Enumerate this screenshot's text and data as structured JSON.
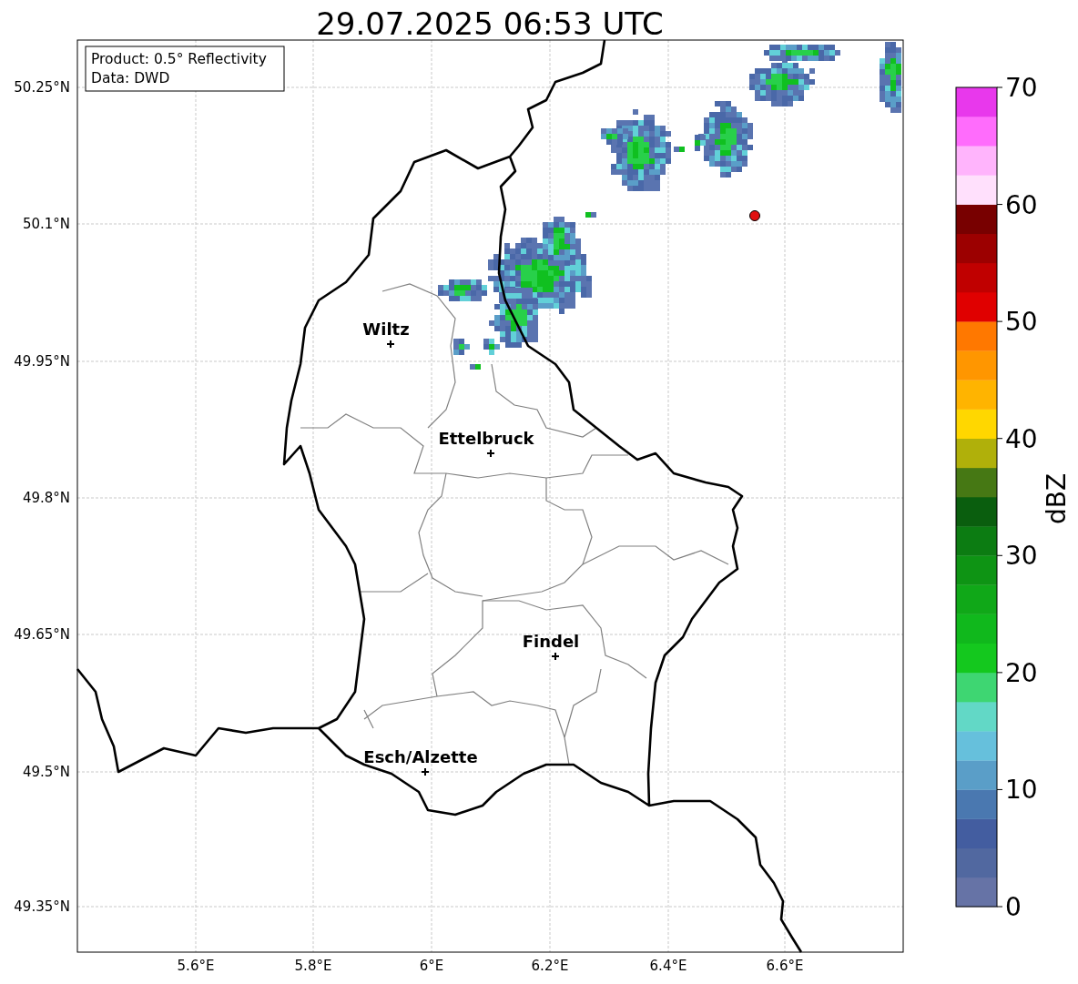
{
  "title": "29.07.2025 06:53 UTC",
  "info_box": {
    "lines": [
      "Product: 0.5° Reflectivity",
      "Data: DWD"
    ]
  },
  "map": {
    "y_ticks": [
      "50.25°N",
      "50.1°N",
      "49.95°N",
      "49.8°N",
      "49.65°N",
      "49.5°N",
      "49.35°N"
    ],
    "x_ticks": [
      "5.6°E",
      "5.8°E",
      "6°E",
      "6.2°E",
      "6.4°E",
      "6.6°E"
    ],
    "cities": [
      {
        "name": "Wiltz"
      },
      {
        "name": "Ettelbruck"
      },
      {
        "name": "Findel"
      },
      {
        "name": "Esch/Alzette"
      }
    ]
  },
  "colorbar": {
    "label": "dBZ",
    "ticks": [
      "70",
      "60",
      "50",
      "40",
      "30",
      "20",
      "10",
      "0"
    ],
    "bins": [
      {
        "color": "#6673a6"
      },
      {
        "color": "#5168a0"
      },
      {
        "color": "#435da0"
      },
      {
        "color": "#4a78b0"
      },
      {
        "color": "#5a9ec8"
      },
      {
        "color": "#66c0dc"
      },
      {
        "color": "#62d8c6"
      },
      {
        "color": "#3ed672"
      },
      {
        "color": "#14c81e"
      },
      {
        "color": "#10b81c"
      },
      {
        "color": "#10a818"
      },
      {
        "color": "#0e9414"
      },
      {
        "color": "#0c7c12"
      },
      {
        "color": "#0a5e0e"
      },
      {
        "color": "#467814"
      },
      {
        "color": "#b0b00a"
      },
      {
        "color": "#ffd700"
      },
      {
        "color": "#ffb400"
      },
      {
        "color": "#ff9600"
      },
      {
        "color": "#ff7800"
      },
      {
        "color": "#e00000"
      },
      {
        "color": "#c00000"
      },
      {
        "color": "#9c0000"
      },
      {
        "color": "#780000"
      },
      {
        "color": "#ffe0fc"
      },
      {
        "color": "#ffb4fc"
      },
      {
        "color": "#ff6cfc"
      },
      {
        "color": "#e838ec"
      }
    ]
  }
}
